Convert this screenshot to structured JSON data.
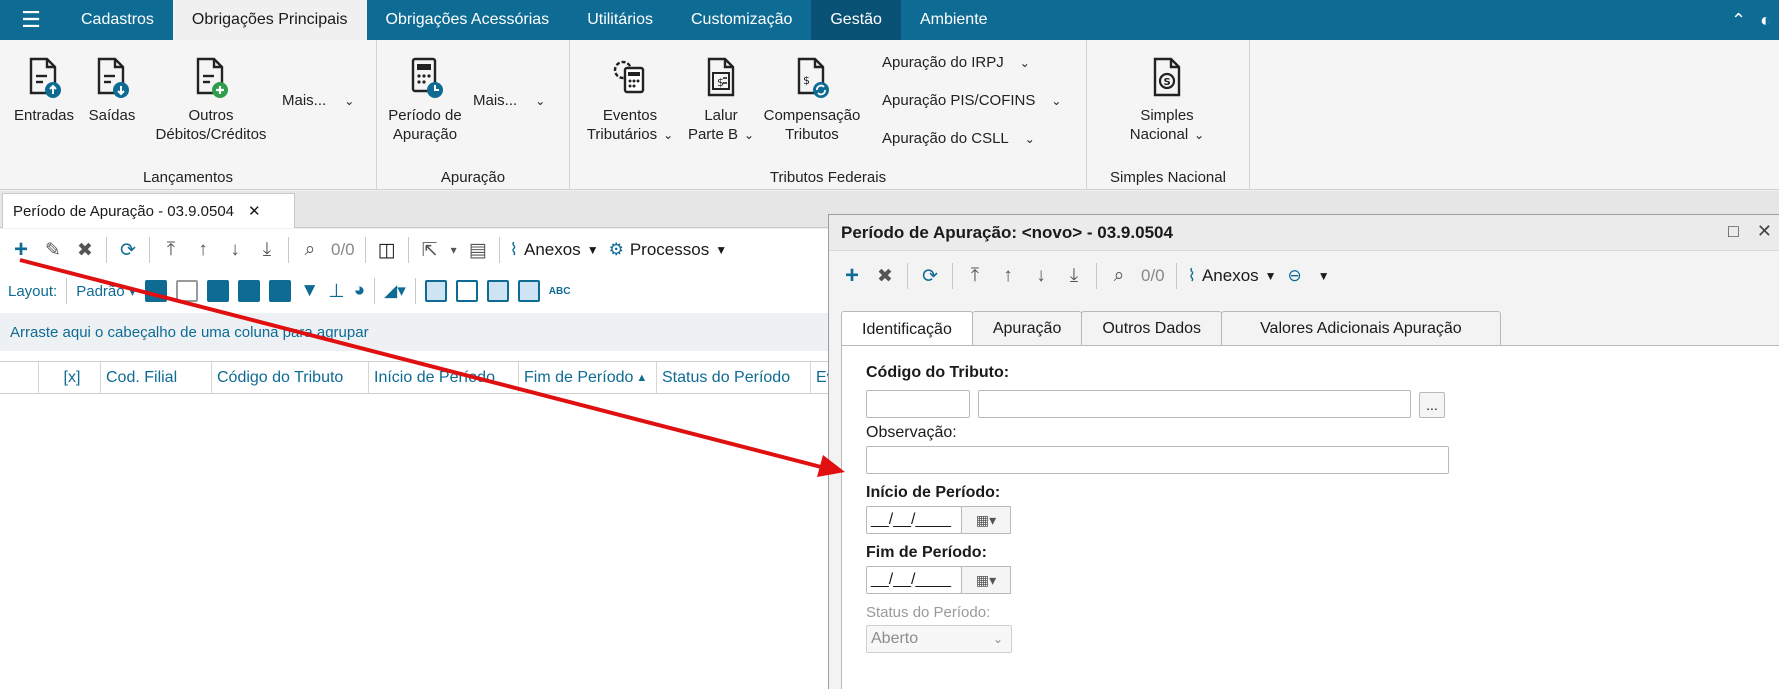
{
  "menu": {
    "tabs": [
      {
        "label": "Cadastros"
      },
      {
        "label": "Obrigações Principais"
      },
      {
        "label": "Obrigações Acessórias"
      },
      {
        "label": "Utilitários"
      },
      {
        "label": "Customização"
      },
      {
        "label": "Gestão"
      },
      {
        "label": "Ambiente"
      }
    ]
  },
  "ribbon": {
    "lancamentos": {
      "label": "Lançamentos",
      "entradas": "Entradas",
      "saidas": "Saídas",
      "outros_1": "Outros",
      "outros_2": "Débitos/Créditos",
      "mais": "Mais..."
    },
    "apuracao": {
      "label": "Apuração",
      "periodo_1": "Período de",
      "periodo_2": "Apuração",
      "mais": "Mais..."
    },
    "tributos": {
      "label": "Tributos Federais",
      "eventos_1": "Eventos",
      "eventos_2": "Tributários",
      "lalur_1": "Lalur",
      "lalur_2": "Parte B",
      "comp_1": "Compensação",
      "comp_2": "Tributos",
      "irpj": "Apuração do IRPJ",
      "pis": "Apuração PIS/COFINS",
      "csll": "Apuração do CSLL"
    },
    "simples": {
      "label": "Simples Nacional",
      "btn_1": "Simples",
      "btn_2": "Nacional"
    }
  },
  "doc_tab": {
    "label": "Período de Apuração - 03.9.0504"
  },
  "left": {
    "toolbar": {
      "counter": "0/0",
      "anexos": "Anexos",
      "processos": "Processos"
    },
    "layout": {
      "label": "Layout:",
      "value": "Padrão"
    },
    "group_hint": "Arraste aqui o cabeçalho de uma coluna para agrupar",
    "columns": [
      "[x]",
      "Cod. Filial",
      "Código do Tributo",
      "Início de Período",
      "Fim de Período",
      "Status do Período",
      "Ev"
    ]
  },
  "modal": {
    "title": "Período de Apuração: <novo> - 03.9.0504",
    "toolbar": {
      "counter": "0/0",
      "anexos": "Anexos"
    },
    "tabs": [
      "Identificação",
      "Apuração",
      "Outros Dados",
      "Valores Adicionais Apuração"
    ],
    "fields": {
      "codigo_tributo": "Código do Tributo:",
      "lookup_btn": "...",
      "observacao": "Observação:",
      "inicio": "Início de Período:",
      "inicio_value": "__/__/____",
      "fim": "Fim de Período:",
      "fim_value": "__/__/____",
      "status": "Status do Período:",
      "status_value": "Aberto"
    }
  },
  "colors": {
    "brand": "#0e6b94",
    "arrow": "#e01010"
  }
}
